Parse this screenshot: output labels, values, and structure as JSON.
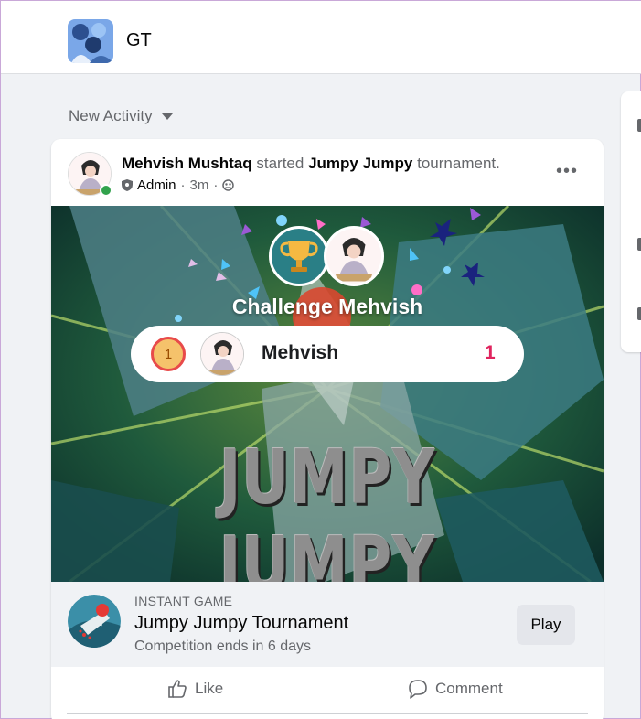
{
  "group": {
    "name": "GT"
  },
  "feed": {
    "sort_label": "New Activity"
  },
  "post": {
    "author": "Mehvish Mushtaq",
    "verb": "started",
    "game": "Jumpy Jumpy",
    "suffix": "tournament.",
    "role": "Admin",
    "time": "3m",
    "separator": "·",
    "more": "•••",
    "challenge_title": "Challenge Mehvish",
    "leaderboard": {
      "rank": "1",
      "player": "Mehvish",
      "score": "1"
    },
    "banner_title": "JUMPY JUMPY"
  },
  "game_card": {
    "type": "INSTANT GAME",
    "title": "Jumpy Jumpy Tournament",
    "subtitle": "Competition ends in 6 days",
    "play_label": "Play"
  },
  "actions": {
    "like": "Like",
    "comment": "Comment"
  },
  "colors": {
    "online": "#31a24c",
    "score": "#e0245e",
    "accent_teal": "#2a7f86"
  },
  "icons": [
    "group-avatar",
    "caret-down-icon",
    "more-icon",
    "shield-icon",
    "globe-icon",
    "trophy-icon",
    "medal-icon",
    "like-icon",
    "comment-icon"
  ]
}
